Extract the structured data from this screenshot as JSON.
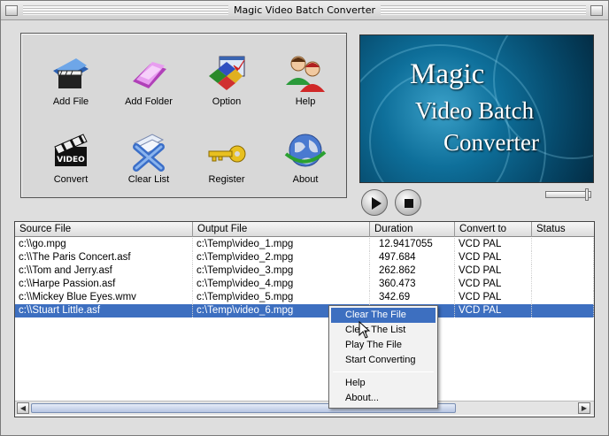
{
  "window": {
    "title": "Magic Video Batch Converter"
  },
  "toolbar": {
    "add_file": "Add File",
    "add_folder": "Add Folder",
    "option": "Option",
    "help": "Help",
    "convert": "Convert",
    "clear_list": "Clear List",
    "register": "Register",
    "about": "About"
  },
  "preview": {
    "line1": "Magic",
    "line2": "Video Batch",
    "line3": "Converter"
  },
  "table": {
    "columns": [
      "Source File",
      "Output File",
      "Duration",
      "Convert to",
      "Status"
    ],
    "rows": [
      [
        "c:\\\\go.mpg",
        "c:\\Temp\\video_1.mpg",
        "12.9417055",
        "VCD PAL",
        ""
      ],
      [
        "c:\\\\The Paris Concert.asf",
        "c:\\Temp\\video_2.mpg",
        "497.684",
        "VCD PAL",
        ""
      ],
      [
        "c:\\\\Tom and Jerry.asf",
        "c:\\Temp\\video_3.mpg",
        "262.862",
        "VCD PAL",
        ""
      ],
      [
        "c:\\\\Harpe Passion.asf",
        "c:\\Temp\\video_4.mpg",
        "360.473",
        "VCD PAL",
        ""
      ],
      [
        "c:\\\\Mickey Blue Eyes.wmv",
        "c:\\Temp\\video_5.mpg",
        "342.69",
        "VCD PAL",
        ""
      ],
      [
        "c:\\\\Stuart Little.asf",
        "c:\\Temp\\video_6.mpg",
        "",
        "VCD PAL",
        ""
      ]
    ]
  },
  "context_menu": {
    "items": [
      "Clear The File",
      "Clear The List",
      "Play The File",
      "Start Converting",
      "Help",
      "About..."
    ]
  },
  "colors": {
    "selection": "#3d6fc0",
    "preview_bg": "#0e6f9a"
  }
}
